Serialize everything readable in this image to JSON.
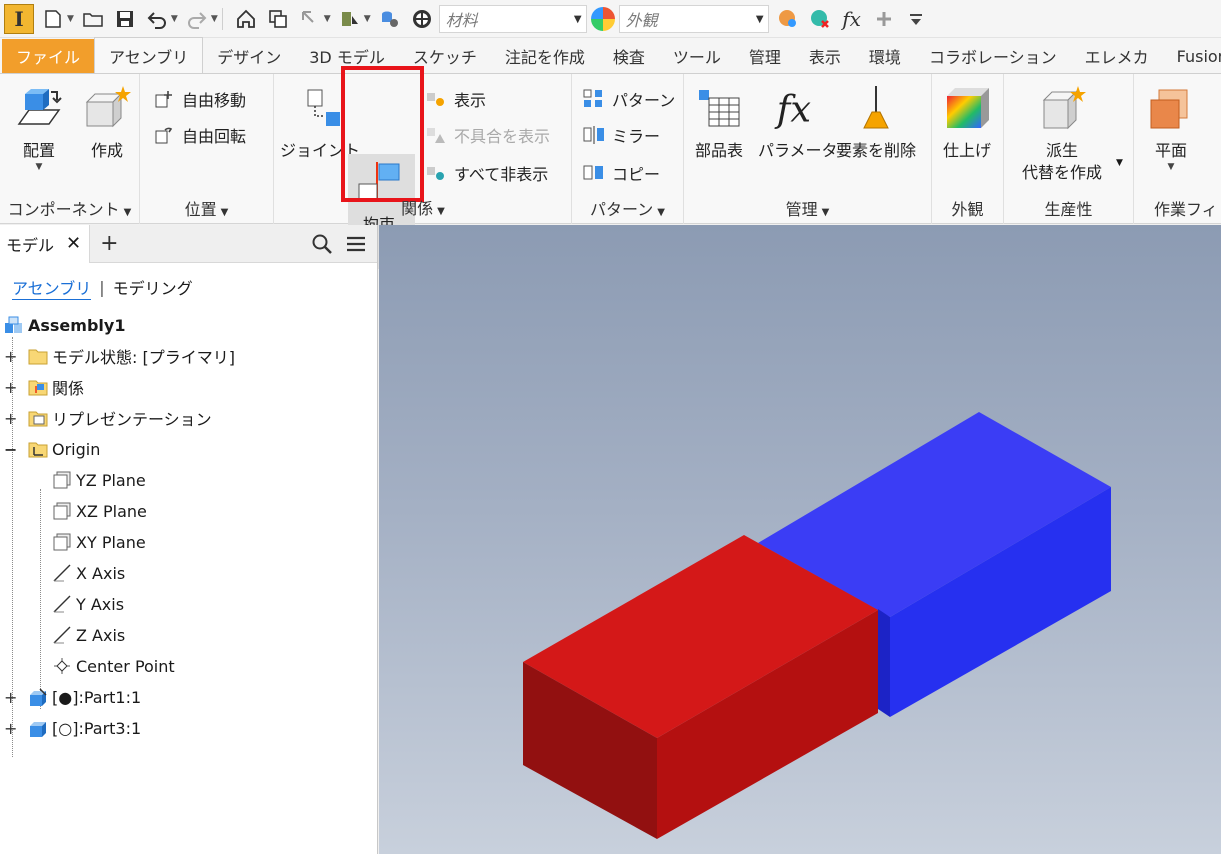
{
  "qat": {
    "app_logo": "I",
    "material_placeholder": "材料",
    "appearance_placeholder": "外観",
    "fx_label": "fx"
  },
  "tabs": [
    {
      "label": "ファイル"
    },
    {
      "label": "アセンブリ"
    },
    {
      "label": "デザイン"
    },
    {
      "label": "3D モデル"
    },
    {
      "label": "スケッチ"
    },
    {
      "label": "注記を作成"
    },
    {
      "label": "検査"
    },
    {
      "label": "ツール"
    },
    {
      "label": "管理"
    },
    {
      "label": "表示"
    },
    {
      "label": "環境"
    },
    {
      "label": "コラボレーション"
    },
    {
      "label": "エレメカ"
    },
    {
      "label": "Fusion"
    }
  ],
  "ribbon": {
    "component": {
      "place": "配置",
      "create": "作成",
      "title": "コンポーネント"
    },
    "position": {
      "free_move": "自由移動",
      "free_rotate": "自由回転",
      "title": "位置"
    },
    "relationships": {
      "joint": "ジョイント",
      "constrain": "拘束",
      "show": "表示",
      "show_sick": "不具合を表示",
      "hide_all": "すべて非表示",
      "title": "関係"
    },
    "pattern": {
      "pattern": "パターン",
      "mirror": "ミラー",
      "copy": "コピー",
      "title": "パターン"
    },
    "manage": {
      "bom": "部品表",
      "parameters": "パラメータ",
      "delete_face": "要素を削除",
      "title": "管理"
    },
    "appearance": {
      "finish": "仕上げ",
      "title": "外観"
    },
    "productivity": {
      "derive_line1": "派生",
      "derive_line2": "代替を作成",
      "title": "生産性"
    },
    "work_features": {
      "plane": "平面",
      "title": "作業フィ"
    }
  },
  "browser": {
    "tab_label": "モデル",
    "subtabs": {
      "assembly": "アセンブリ",
      "modeling": "モデリング"
    },
    "tree": [
      {
        "label": "Assembly1"
      },
      {
        "label": "モデル状態: [プライマリ]"
      },
      {
        "label": "関係"
      },
      {
        "label": "リプレゼンテーション"
      },
      {
        "label": "Origin"
      },
      {
        "label": "YZ Plane"
      },
      {
        "label": "XZ Plane"
      },
      {
        "label": "XY Plane"
      },
      {
        "label": "X Axis"
      },
      {
        "label": "Y Axis"
      },
      {
        "label": "Z Axis"
      },
      {
        "label": "Center Point"
      },
      {
        "label": "[●]:Part1:1"
      },
      {
        "label": "[○]:Part3:1"
      }
    ]
  },
  "colors": {
    "file_tab": "#f29e2b",
    "highlight": "#e8141a",
    "red_block": "#d21616",
    "blue_block": "#2a32f0"
  }
}
